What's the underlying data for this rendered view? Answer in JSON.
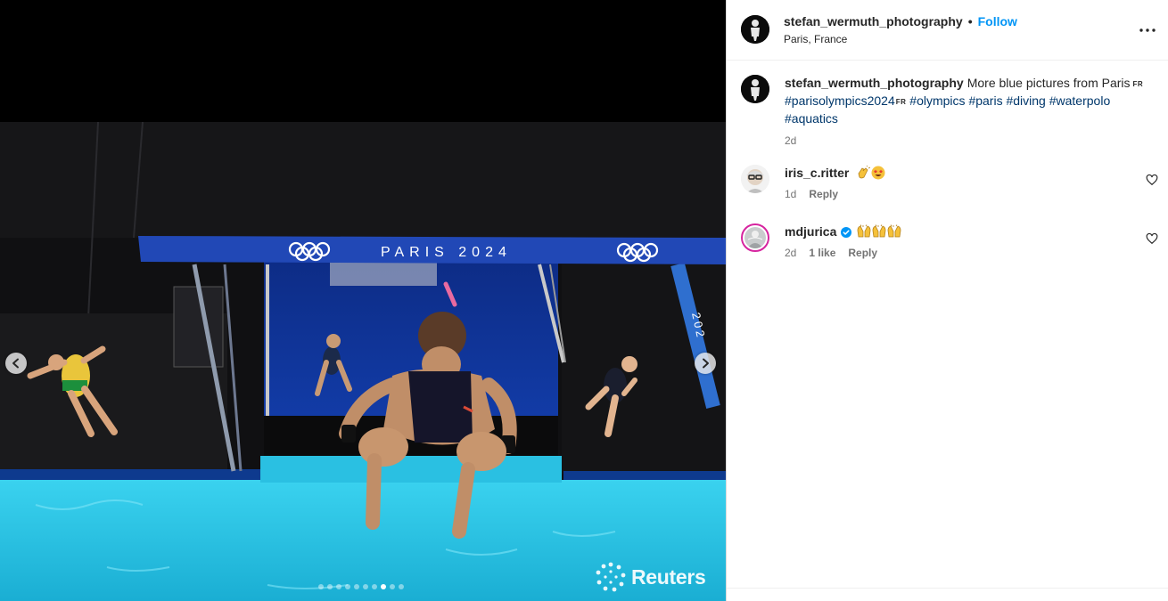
{
  "post": {
    "username": "stefan_wermuth_photography",
    "separator": "•",
    "follow_label": "Follow",
    "location": "Paris, France",
    "more_icon": "more-horizontal-icon"
  },
  "media": {
    "watermark": "Reuters",
    "board_banner": "PARIS 2024",
    "side_banner": "202",
    "carousel": {
      "total": 10,
      "active_index": 7
    },
    "prev_icon": "chevron-left-icon",
    "next_icon": "chevron-right-icon"
  },
  "caption": {
    "username": "stefan_wermuth_photography",
    "text": "More blue pictures from Paris",
    "flag1": "FR",
    "hashtag1": "#parisolympics2024",
    "flag2": "FR",
    "hashtags_rest": [
      "#olympics",
      "#paris",
      "#diving",
      "#waterpolo",
      "#aquatics"
    ],
    "age": "2d"
  },
  "comments": [
    {
      "username": "iris_c.ritter",
      "emojis": [
        "clapping-hands-emoji",
        "star-struck-emoji"
      ],
      "age": "1d",
      "likes": "",
      "reply_label": "Reply"
    },
    {
      "username": "mdjurica",
      "verified": true,
      "emojis": [
        "raising-hands-emoji",
        "raising-hands-emoji",
        "raising-hands-emoji"
      ],
      "age": "2d",
      "likes": "1 like",
      "reply_label": "Reply"
    }
  ],
  "colors": {
    "link_blue": "#0095f6",
    "hashtag": "#00376b",
    "muted": "#737373",
    "text": "#262626",
    "pool": "#29c4e6",
    "board": "#1e3ea0"
  }
}
